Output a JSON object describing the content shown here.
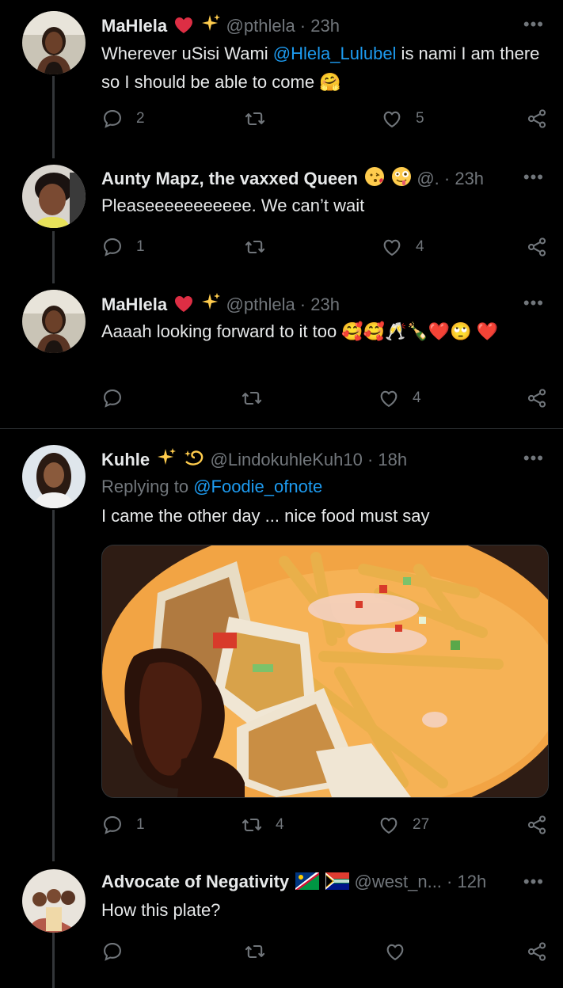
{
  "tweets": [
    {
      "name": "MaHlela",
      "handle": "@pthlela · 23h",
      "text_pre": "Wherever uSisi Wami ",
      "mention": "@Hlela_Lulubel",
      "text_post": " is nami I am there so I should be able to come 🤗",
      "replies": "2",
      "retweets": "",
      "likes": "5"
    },
    {
      "name": "Aunty Mapz, the vaxxed Queen",
      "handle": "@. · 23h",
      "text": "Pleaseeeeeeeeeee. We can’t wait",
      "replies": "1",
      "retweets": "",
      "likes": "4"
    },
    {
      "name": "MaHlela",
      "handle": "@pthlela · 23h",
      "text": "Aaaah looking forward to it too 🥰🥰🥂🍾❤️🙄 ❤️",
      "replies": "",
      "retweets": "",
      "likes": "4"
    },
    {
      "name": "Kuhle",
      "handle": "@LindokuhleKuh10 · 18h",
      "replying_prefix": "Replying to ",
      "replying_to": "@Foodie_ofnote",
      "text": "I came the other day ... nice food must say",
      "replies": "1",
      "retweets": "4",
      "likes": "27"
    },
    {
      "name": "Advocate of Negativity",
      "handle": "@west_n... · 12h",
      "text": "How this plate?",
      "replies": "",
      "retweets": "",
      "likes": ""
    }
  ],
  "more_label": "•••",
  "colors": {
    "background": "#000000",
    "text": "#e7e9ea",
    "muted": "#71767b",
    "link": "#1d9bf0",
    "heart": "#e0245e"
  },
  "icons": [
    "reply-icon",
    "retweet-icon",
    "like-icon",
    "share-icon",
    "more-icon"
  ]
}
